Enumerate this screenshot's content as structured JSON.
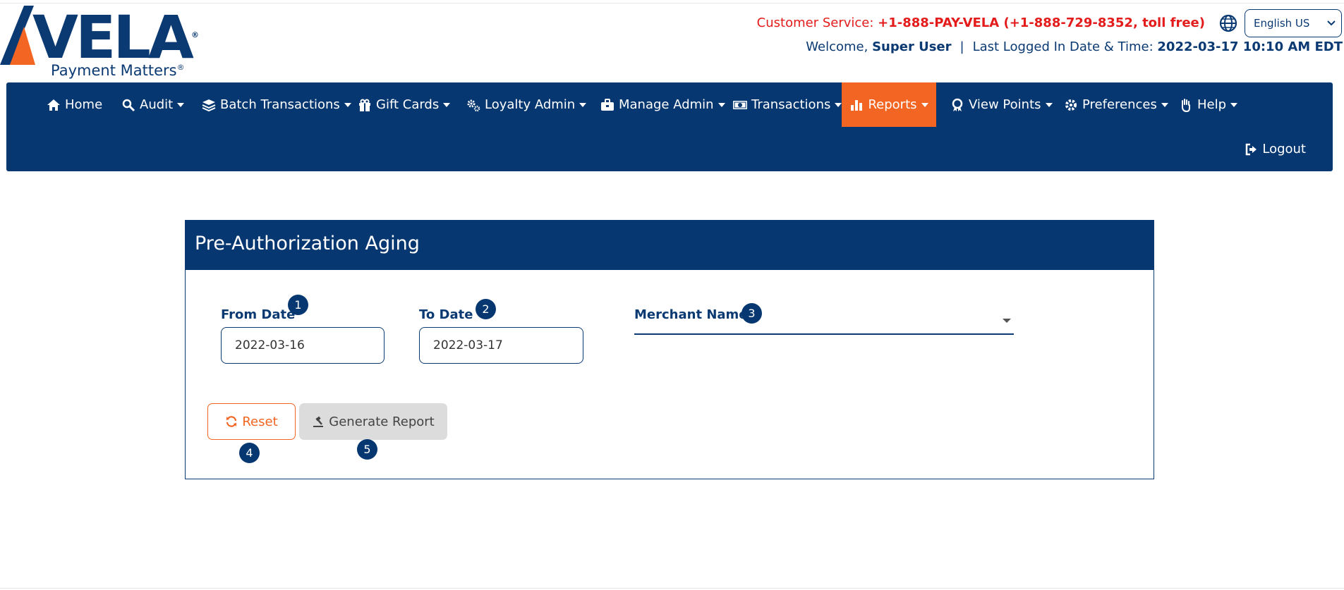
{
  "brand": {
    "logo_text": "VELA",
    "tagline": "Payment Matters",
    "registered_mark": "®"
  },
  "header": {
    "customer_service_label": "Customer Service:",
    "customer_service_value": "+1-888-PAY-VELA (+1-888-729-8352, toll free)",
    "language_selected": "English US",
    "welcome_label": "Welcome,",
    "user_name": "Super User",
    "separator": "|",
    "last_logged_label": "Last Logged In Date & Time:",
    "last_logged_value": "2022-03-17 10:10 AM EDT"
  },
  "nav": {
    "items": [
      {
        "label": "Home",
        "icon": "home-icon"
      },
      {
        "label": "Audit",
        "icon": "search-icon"
      },
      {
        "label": "Batch Transactions",
        "icon": "layers-icon"
      },
      {
        "label": "Gift Cards",
        "icon": "gift-icon"
      },
      {
        "label": "Loyalty Admin",
        "icon": "cogs-icon"
      },
      {
        "label": "Manage Admin",
        "icon": "briefcase-icon"
      },
      {
        "label": "Transactions",
        "icon": "money-icon"
      },
      {
        "label": "Reports",
        "icon": "bar-chart-icon",
        "active": true
      },
      {
        "label": "View Points",
        "icon": "award-icon"
      },
      {
        "label": "Preferences",
        "icon": "gear-icon"
      },
      {
        "label": "Help",
        "icon": "hand-icon"
      }
    ],
    "logout_label": "Logout"
  },
  "panel": {
    "title": "Pre-Authorization Aging",
    "from_date_label": "From Date",
    "from_date_value": "2022-03-16",
    "to_date_label": "To Date",
    "to_date_value": "2022-03-17",
    "merchant_label": "Merchant Name",
    "required_mark": "*",
    "merchant_value": "",
    "reset_label": "Reset",
    "generate_label": "Generate Report"
  },
  "badges": [
    "1",
    "2",
    "3",
    "4",
    "5"
  ],
  "colors": {
    "navy": "#063770",
    "orange": "#f26522",
    "red": "#e31b1b"
  }
}
